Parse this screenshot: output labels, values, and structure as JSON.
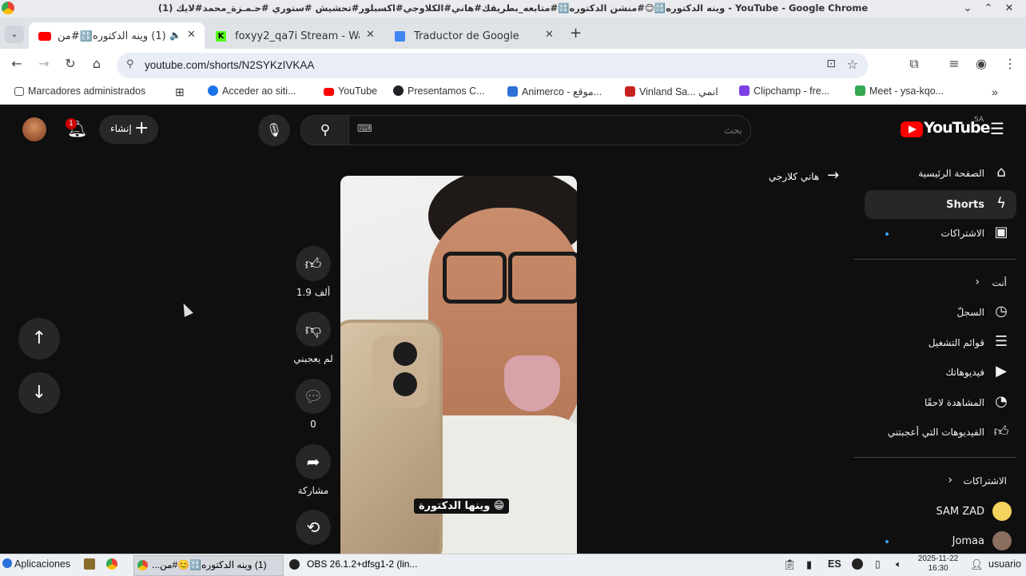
{
  "window": {
    "title": "(1) وينه الدكتوره🔠😊#منشن الدكتوره🔠#متابعه_بطريقك#هاني#الكلاوجي#اكسبلور#تحشيش #ستوري #حـمـزة_محمد#لايك - YouTube - Google Chrome",
    "minimize": "⌄",
    "maximize": "⌃",
    "close": "✕"
  },
  "tabs": [
    {
      "label": "(1) وينه الدكتوره🔠#من",
      "active": true
    },
    {
      "label": "foxyy2_qa7i Stream - Wa",
      "active": false
    },
    {
      "label": "Traductor de Google",
      "active": false
    }
  ],
  "new_tab": "+",
  "address": {
    "url": "youtube.com/shorts/N2SYKzIVKAA"
  },
  "bookmarks": [
    {
      "label": "Marcadores administrados",
      "color": "#5f6368"
    },
    {
      "label": "Acceder ao siti...",
      "color": "#1a73e8"
    },
    {
      "label": "YouTube",
      "color": "#ff0000"
    },
    {
      "label": "Presentamos C...",
      "color": "#202124"
    },
    {
      "label": "Animerco - موقع...",
      "color": "#2d6fd4"
    },
    {
      "label": "Vinland Sa... انمي",
      "color": "#c5221f"
    },
    {
      "label": "Clipchamp - fre...",
      "color": "#7b3fe4"
    },
    {
      "label": "Meet - ysa-kqo...",
      "color": "#34a853"
    }
  ],
  "youtube": {
    "logo_text": "YouTube",
    "country": "SA",
    "search_placeholder": "بحث",
    "create_label": "إنشاء",
    "notifications_count": "1",
    "channel_link": "هاني كلارجي",
    "caption": "وينها الدكتورة 😁",
    "actions": {
      "likes": "1.9 ألف",
      "dislike_label": "لم يعجبني",
      "comments": "0",
      "share_label": "مشاركة"
    },
    "sidebar": {
      "home": "الصفحة الرئيسية",
      "shorts": "Shorts",
      "subscriptions": "الاشتراكات",
      "you_header": "أنت",
      "history": "السجلّ",
      "playlists": "قوائم التشغيل",
      "your_videos": "فيديوهاتك",
      "watch_later": "المشاهدة لاحقًا",
      "liked_videos": "الفيديوهات التي أعجبتني",
      "subs_header": "الاشتراكات",
      "sub_1": "SAM ZAD",
      "sub_2": "Jomaa"
    }
  },
  "taskbar": {
    "apps_label": "Aplicaciones",
    "task_chrome": "(1) وينه الدكتوره🔠😊#من...",
    "task_obs": "OBS 26.1.2+dfsg1-2 (lin...",
    "lang": "ES",
    "date": "2025-11-22",
    "time": "16:30",
    "user": "usuario"
  }
}
